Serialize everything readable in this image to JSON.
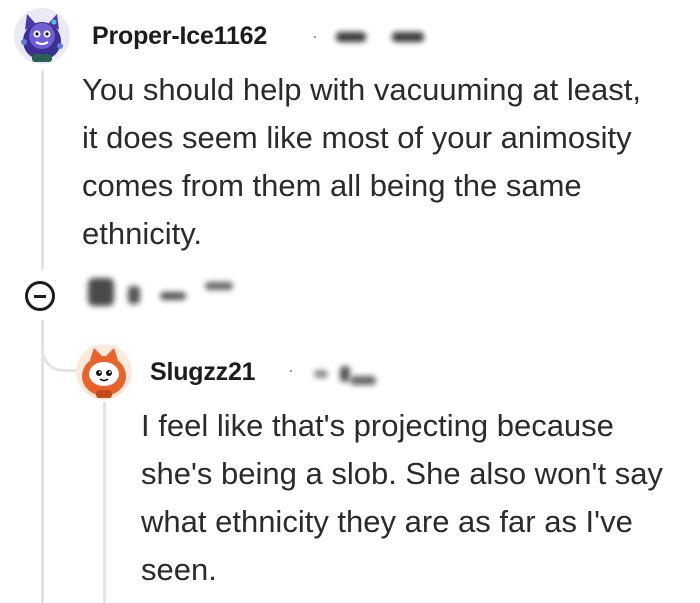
{
  "comments": [
    {
      "username": "Proper-Ice1162",
      "separator": "·",
      "body": "You should help with vacuuming at least,\nit does seem like most of your animosity\ncomes from them all being the same\nethnicity."
    },
    {
      "username": "Slugzz21",
      "separator": "·",
      "body": "I feel like that's projecting because\nshe's being a slob. She also won't say\nwhat ethnicity they are as far as I've\nseen."
    }
  ],
  "icons": {
    "collapse": "collapse-minus-icon",
    "avatar_1": "purple-cat-avatar",
    "avatar_2": "orange-hood-snoo-avatar"
  },
  "colors": {
    "thread_line": "#e3e3e3",
    "text": "#1c1c1c",
    "meta": "#8a8a8a"
  }
}
